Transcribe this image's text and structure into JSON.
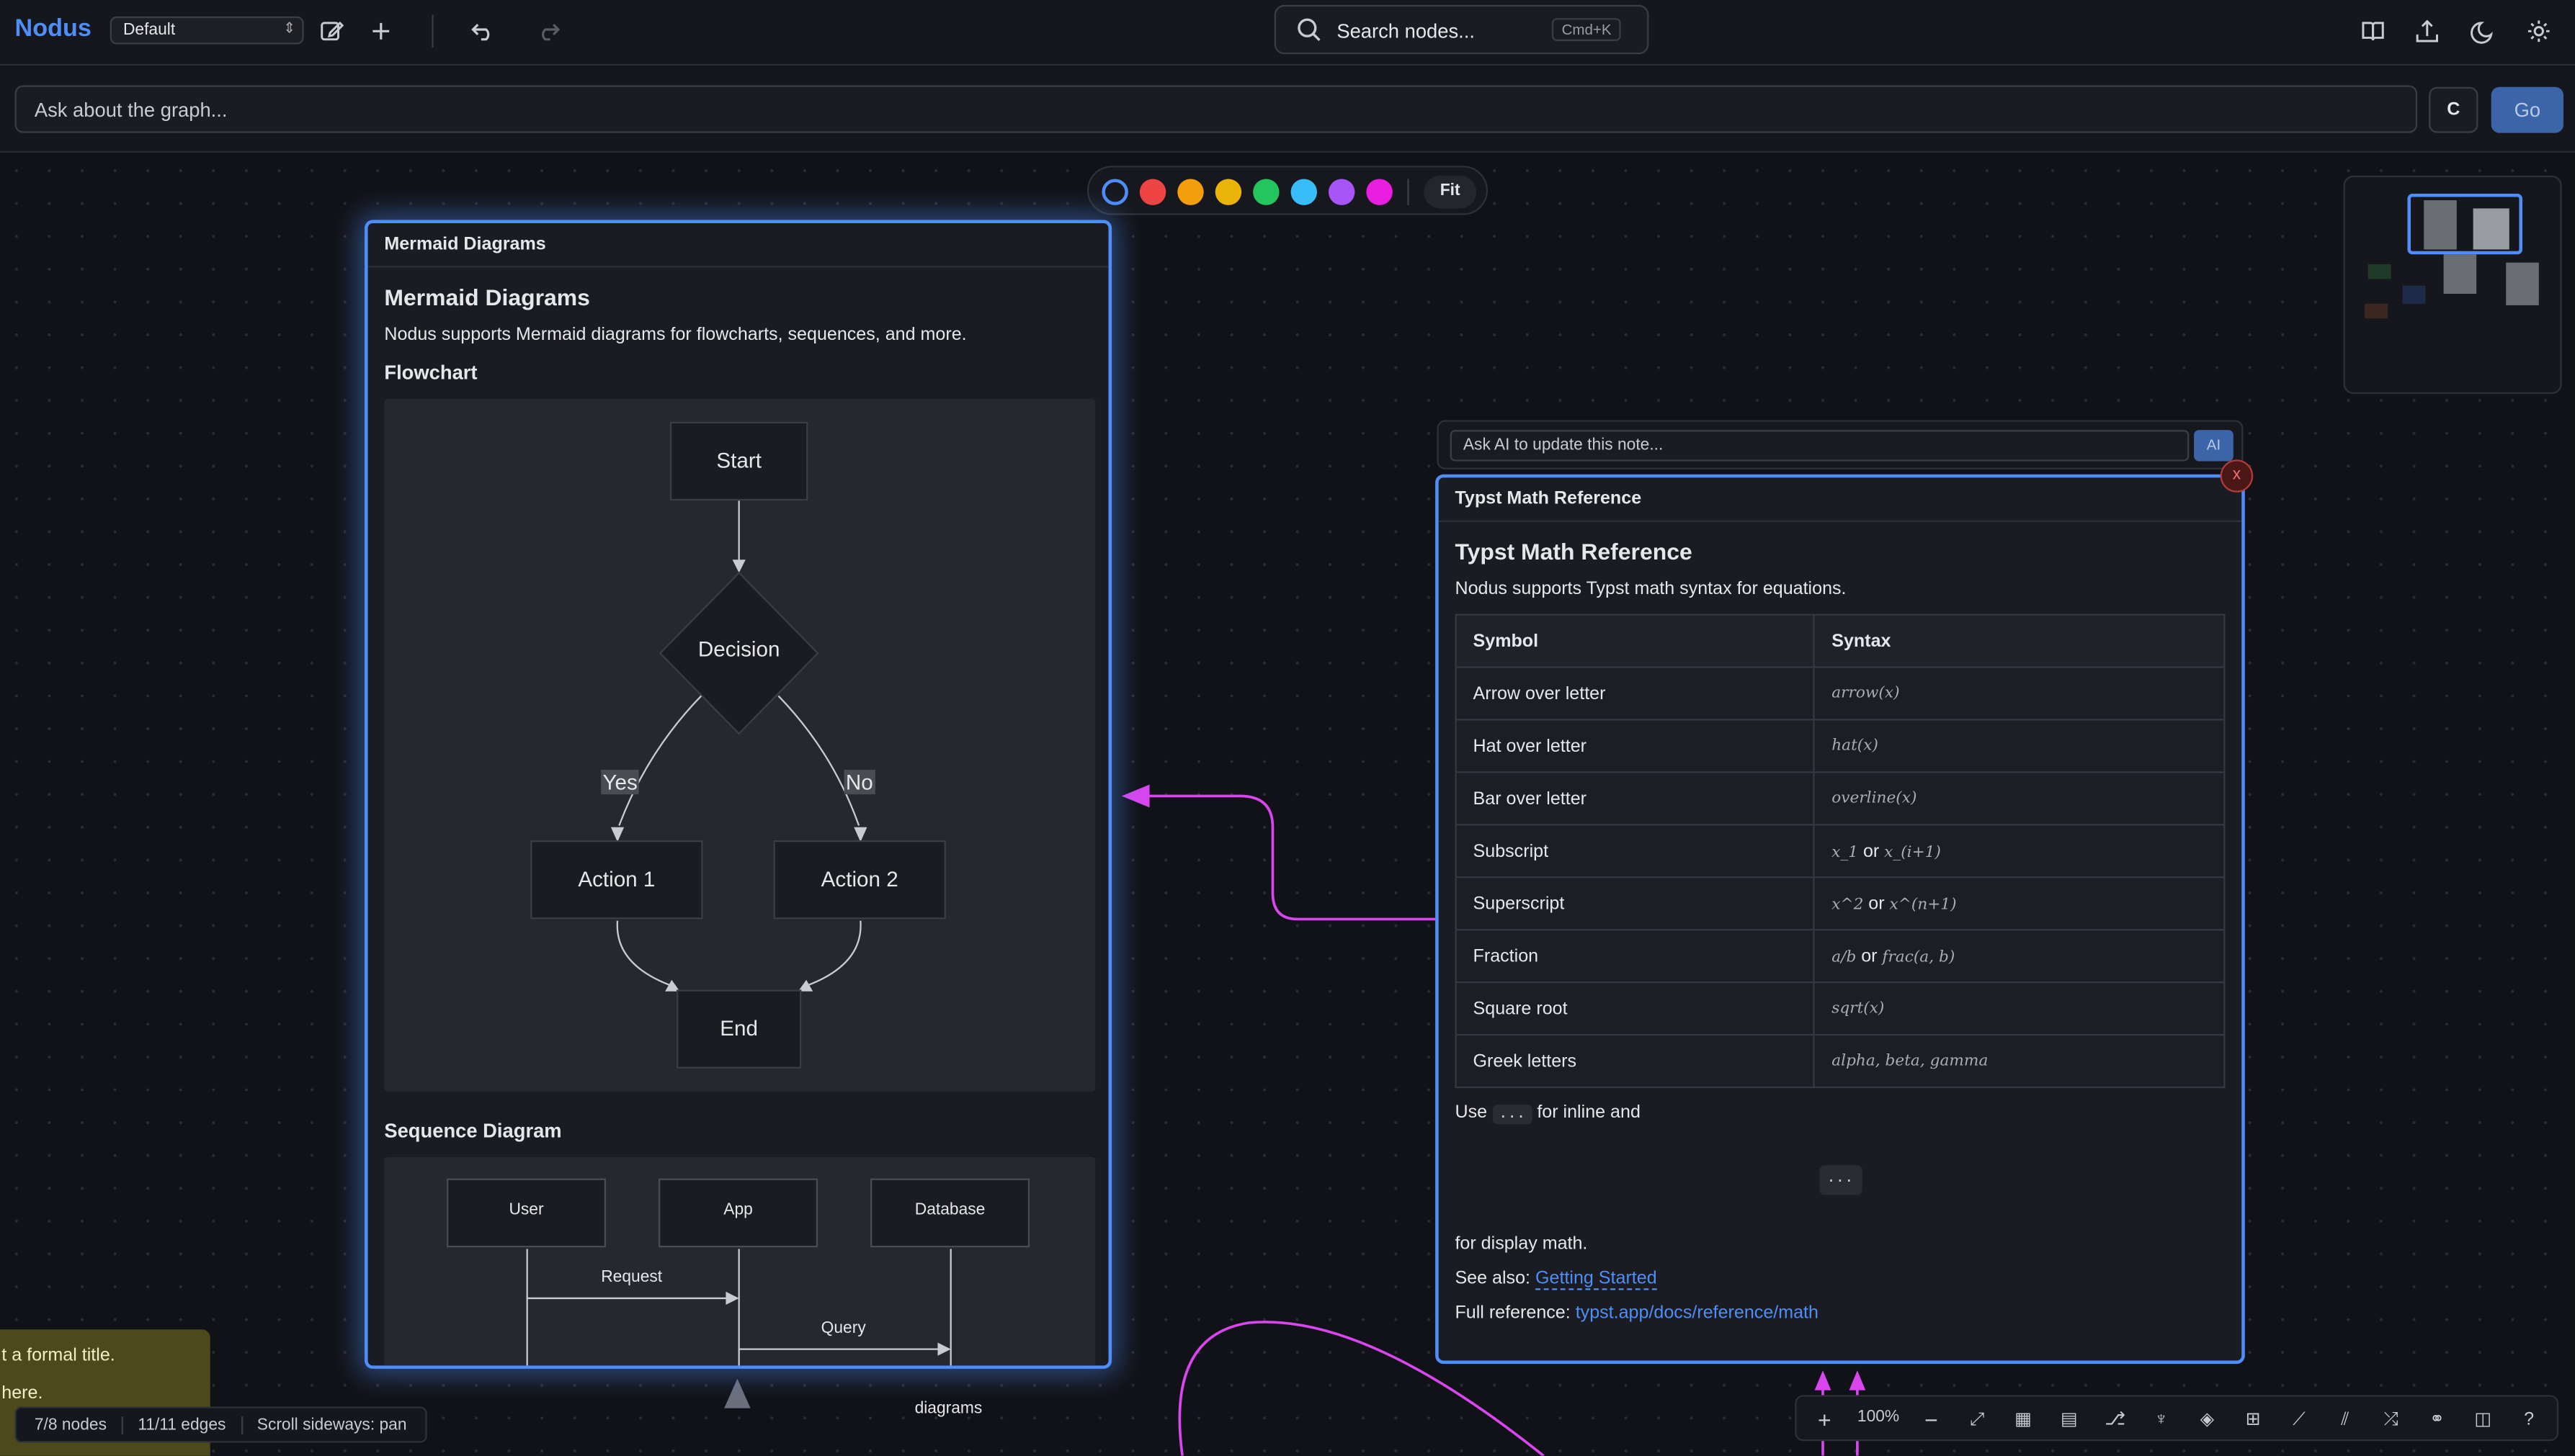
{
  "app": {
    "brand": "Nodus",
    "preset": "Default"
  },
  "search": {
    "placeholder": "Search nodes...",
    "shortcut": "Cmd+K"
  },
  "ask": {
    "placeholder": "Ask about the graph...",
    "clear_label": "C",
    "go_label": "Go"
  },
  "palette": {
    "colors": [
      "#ef4444",
      "#f59e0b",
      "#eab308",
      "#22c55e",
      "#38bdf8",
      "#a855f7",
      "#e91ee0"
    ],
    "fit_label": "Fit"
  },
  "mermaid_card": {
    "header": "Mermaid Diagrams",
    "title": "Mermaid Diagrams",
    "intro": "Nodus supports Mermaid diagrams for flowcharts, sequences, and more.",
    "flowchart_heading": "Flowchart",
    "flowchart": {
      "start": "Start",
      "decision": "Decision",
      "yes": "Yes",
      "no": "No",
      "action1": "Action 1",
      "action2": "Action 2",
      "end": "End"
    },
    "sequence_heading": "Sequence Diagram",
    "sequence": {
      "actors": [
        "User",
        "App",
        "Database"
      ],
      "msg1": "Request",
      "msg2": "Query"
    }
  },
  "typst_card": {
    "ai_placeholder": "Ask AI to update this note...",
    "ai_button": "AI",
    "close_label": "x",
    "header": "Typst Math Reference",
    "title": "Typst Math Reference",
    "intro": "Nodus supports Typst math syntax for equations.",
    "table_headers": [
      "Symbol",
      "Syntax"
    ],
    "rows": [
      {
        "symbol": "Arrow over letter",
        "syntax": "arrow(x)"
      },
      {
        "symbol": "Hat over letter",
        "syntax": "hat(x)"
      },
      {
        "symbol": "Bar over letter",
        "syntax": "overline(x)"
      },
      {
        "symbol": "Subscript",
        "syntax_a": "x_1",
        "or": "or",
        "syntax_b": "x_(i+1)"
      },
      {
        "symbol": "Superscript",
        "syntax_a": "x^2",
        "or": "or",
        "syntax_b": "x^(n+1)"
      },
      {
        "symbol": "Fraction",
        "syntax_a": "a/b",
        "or": "or",
        "syntax_b": "frac(a, b)"
      },
      {
        "symbol": "Square root",
        "syntax": "sqrt(x)"
      },
      {
        "symbol": "Greek letters",
        "syntax": "alpha, beta, gamma"
      }
    ],
    "use_prefix": "Use",
    "use_code": "...",
    "use_suffix": "for inline and",
    "block_code": "...",
    "display_text": "for display math.",
    "see_also_prefix": "See also:",
    "see_also_link": "Getting Started",
    "full_ref_prefix": "Full reference:",
    "full_ref_link": "typst.app/docs/reference/math"
  },
  "yellow_note": {
    "line1": "t a formal title.",
    "line2": " here."
  },
  "status": {
    "nodes": "7/8 nodes",
    "edges": "11/11 edges",
    "hint": "Scroll sideways: pan"
  },
  "node_label": "diagrams",
  "zoom": "100%",
  "colors": {
    "accent": "#4f8df7",
    "edge": "#d946ef",
    "background": "#111217"
  }
}
